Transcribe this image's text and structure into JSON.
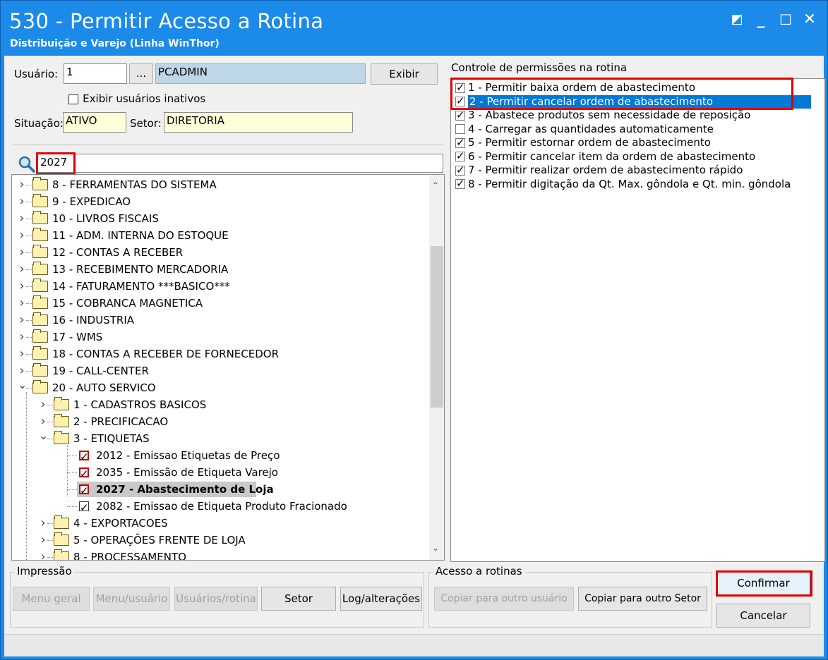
{
  "window": {
    "title": "530 - Permitir Acesso a Rotina",
    "subtitle": "Distribuição e Varejo (Linha WinThor)"
  },
  "user": {
    "usuario_label": "Usuário:",
    "usuario_value": "1",
    "browse_label": "...",
    "username": "PCADMIN",
    "exibir_label": "Exibir",
    "inactive_label": "Exibir usuários inativos",
    "situacao_label": "Situação:",
    "situacao_value": "ATIVO",
    "setor_label": "Setor:",
    "setor_value": "DIRETORIA"
  },
  "search": {
    "value": "2027"
  },
  "tree": {
    "items": [
      "8 - FERRAMENTAS DO SISTEMA",
      "9 - EXPEDICAO",
      "10 - LIVROS FISCAIS",
      "11 - ADM. INTERNA DO ESTOQUE",
      "12 - CONTAS A RECEBER",
      "13 - RECEBIMENTO MERCADORIA",
      "14 - FATURAMENTO     ***BASICO***",
      "15 - COBRANCA MAGNETICA",
      "16 - INDUSTRIA",
      "17 - WMS",
      "18 - CONTAS A RECEBER DE FORNECEDOR",
      "19 - CALL-CENTER",
      "20 - AUTO SERVICO",
      "1 - CADASTROS BASICOS",
      "2 - PRECIFICACAO",
      "3 - ETIQUETAS",
      "2012 - Emissao Etiquetas de Preço",
      "2035 - Emissão de Etiqueta Varejo",
      "2027 - Abastecimento de Loja",
      "2082 - Emissao de Etiqueta Produto Fracionado",
      "4 - EXPORTACOES",
      "5 - OPERAÇÕES FRENTE DE LOJA",
      "8 - PROCESSAMENTO"
    ]
  },
  "permissions": {
    "title": "Controle de permissões na rotina",
    "items": [
      {
        "label": "1 - Permitir baixa ordem de abastecimento",
        "checked": true
      },
      {
        "label": "2 - Permitir cancelar ordem de abastecimento",
        "checked": true
      },
      {
        "label": "3 - Abastece produtos sem necessidade de reposição",
        "checked": true
      },
      {
        "label": "4 - Carregar as quantidades automaticamente",
        "checked": false
      },
      {
        "label": "5 - Permitir estornar ordem de abastecimento",
        "checked": true
      },
      {
        "label": "6 - Permitir cancelar item da ordem de abastecimento",
        "checked": true
      },
      {
        "label": "7 - Permitir realizar ordem de abastecimento rápido",
        "checked": true
      },
      {
        "label": "8 - Permitir digitação da Qt. Max. gôndola e Qt. min. gôndola",
        "checked": true
      }
    ]
  },
  "impressao": {
    "title": "Impressão",
    "menu_geral": "Menu geral",
    "menu_usuario": "Menu/usuário",
    "usuarios_rotina": "Usuários/rotina",
    "setor": "Setor",
    "log": "Log/alterações"
  },
  "acesso": {
    "title": "Acesso a rotinas",
    "copiar_usuario": "Copiar para outro usuário",
    "copiar_setor": "Copiar para outro Setor"
  },
  "actions": {
    "confirmar": "Confirmar",
    "cancelar": "Cancelar"
  },
  "colors": {
    "titlebar": "#1b8ae8",
    "highlight": "#0078d7",
    "annotation": "#e00000"
  }
}
